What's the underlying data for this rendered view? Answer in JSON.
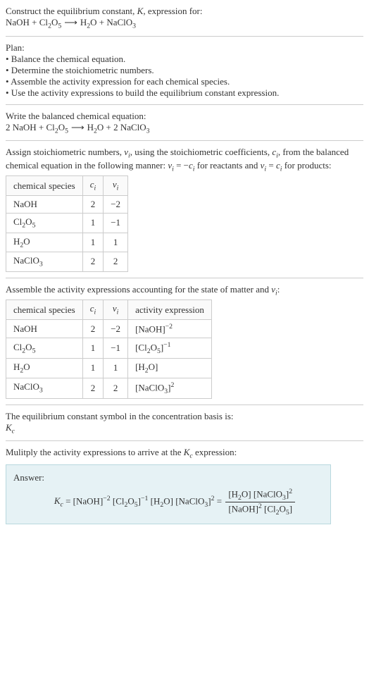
{
  "intro": {
    "line1": "Construct the equilibrium constant, K, expression for:",
    "eq": "NaOH + Cl₂O₅  ⟶  H₂O + NaClO₃"
  },
  "plan": {
    "header": "Plan:",
    "b1": "• Balance the chemical equation.",
    "b2": "• Determine the stoichiometric numbers.",
    "b3": "• Assemble the activity expression for each chemical species.",
    "b4": "• Use the activity expressions to build the equilibrium constant expression."
  },
  "balanced": {
    "header": "Write the balanced chemical equation:",
    "eq": "2 NaOH + Cl₂O₅  ⟶  H₂O + 2 NaClO₃"
  },
  "stoich": {
    "header_a": "Assign stoichiometric numbers, νᵢ, using the stoichiometric coefficients, cᵢ, from the balanced chemical equation in the following manner: νᵢ = −cᵢ for reactants and νᵢ = cᵢ for products:",
    "th": {
      "species": "chemical species",
      "c": "cᵢ",
      "v": "νᵢ"
    },
    "rows": [
      {
        "species": "NaOH",
        "c": "2",
        "v": "−2"
      },
      {
        "species": "Cl₂O₅",
        "c": "1",
        "v": "−1"
      },
      {
        "species": "H₂O",
        "c": "1",
        "v": "1"
      },
      {
        "species": "NaClO₃",
        "c": "2",
        "v": "2"
      }
    ]
  },
  "activity": {
    "header": "Assemble the activity expressions accounting for the state of matter and νᵢ:",
    "th": {
      "species": "chemical species",
      "c": "cᵢ",
      "v": "νᵢ",
      "act": "activity expression"
    },
    "rows": [
      {
        "species": "NaOH",
        "c": "2",
        "v": "−2",
        "act": "[NaOH]⁻²"
      },
      {
        "species": "Cl₂O₅",
        "c": "1",
        "v": "−1",
        "act": "[Cl₂O₅]⁻¹"
      },
      {
        "species": "H₂O",
        "c": "1",
        "v": "1",
        "act": "[H₂O]"
      },
      {
        "species": "NaClO₃",
        "c": "2",
        "v": "2",
        "act": "[NaClO₃]²"
      }
    ]
  },
  "symbol": {
    "line1": "The equilibrium constant symbol in the concentration basis is:",
    "line2": "K𞁞"
  },
  "multiply": {
    "header": "Mulitply the activity expressions to arrive at the K𞁞 expression:"
  },
  "answer": {
    "label": "Answer:",
    "lhs": "K𞁞 = [NaOH]⁻² [Cl₂O₅]⁻¹ [H₂O] [NaClO₃]² = ",
    "num": "[H₂O] [NaClO₃]²",
    "den": "[NaOH]² [Cl₂O₅]"
  }
}
